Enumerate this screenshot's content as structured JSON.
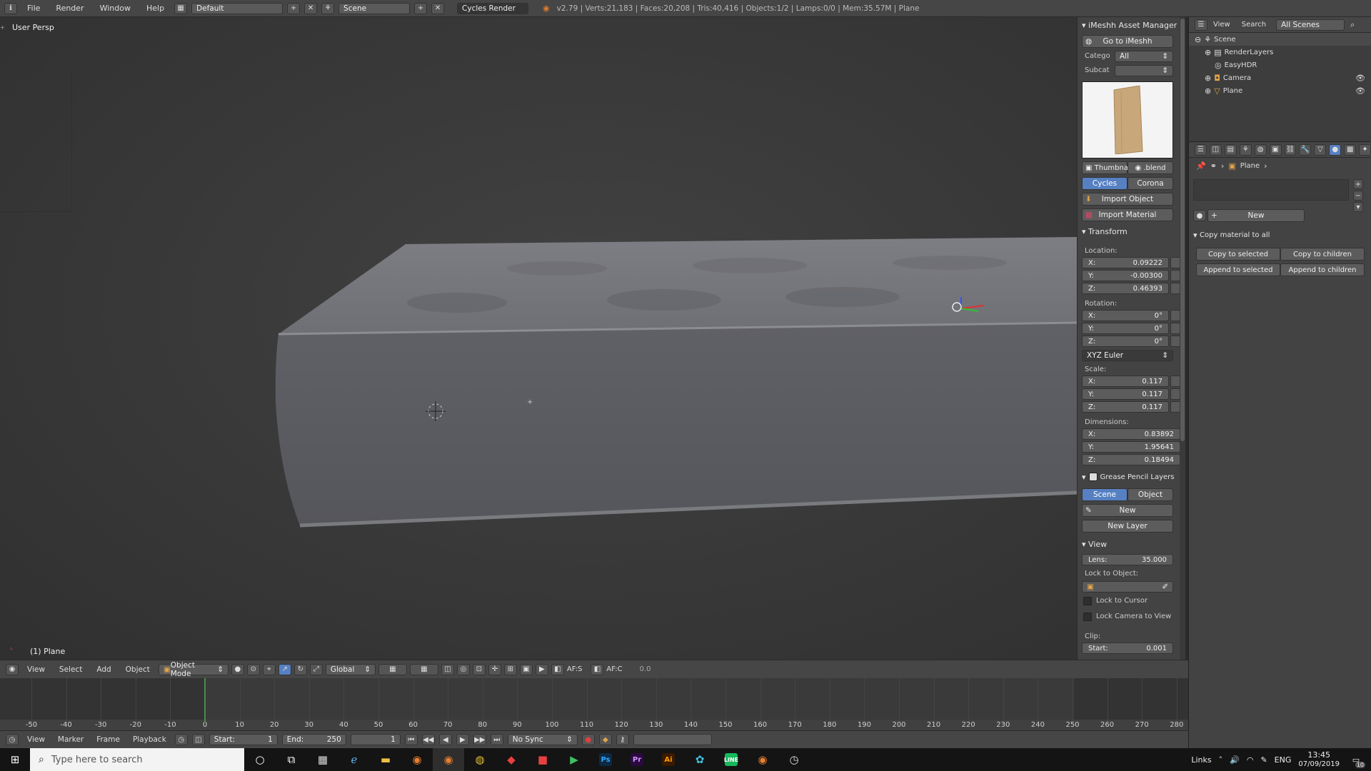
{
  "topbar": {
    "menus": [
      "File",
      "Render",
      "Window",
      "Help"
    ],
    "layout": "Default",
    "scene": "Scene",
    "engine": "Cycles Render",
    "stats": "v2.79 | Verts:21,183 | Faces:20,208 | Tris:40,416 | Objects:1/2 | Lamps:0/0 | Mem:35.57M | Plane"
  },
  "viewport": {
    "view_label": "User Persp",
    "object_label": "(1) Plane"
  },
  "imeshh": {
    "title": "iMeshh Asset Manager",
    "goto": "Go to iMeshh",
    "category_label": "Catego",
    "category_value": "All",
    "subcat_label": "Subcat",
    "subcat_value": "",
    "thumbnail": "Thumbnai",
    "blend": ".blend",
    "renderer_tabs": [
      "Cycles",
      "Corona"
    ],
    "import_object": "Import Object",
    "import_material": "Import Material"
  },
  "transform": {
    "title": "Transform",
    "location_label": "Location:",
    "location": [
      {
        "axis": "X:",
        "value": "0.09222"
      },
      {
        "axis": "Y:",
        "value": "-0.00300"
      },
      {
        "axis": "Z:",
        "value": "0.46393"
      }
    ],
    "rotation_label": "Rotation:",
    "rotation": [
      {
        "axis": "X:",
        "value": "0°"
      },
      {
        "axis": "Y:",
        "value": "0°"
      },
      {
        "axis": "Z:",
        "value": "0°"
      }
    ],
    "rotation_mode": "XYZ Euler",
    "scale_label": "Scale:",
    "scale": [
      {
        "axis": "X:",
        "value": "0.117"
      },
      {
        "axis": "Y:",
        "value": "0.117"
      },
      {
        "axis": "Z:",
        "value": "0.117"
      }
    ],
    "dimensions_label": "Dimensions:",
    "dimensions": [
      {
        "axis": "X:",
        "value": "0.83892"
      },
      {
        "axis": "Y:",
        "value": "1.95641"
      },
      {
        "axis": "Z:",
        "value": "0.18494"
      }
    ]
  },
  "grease": {
    "title": "Grease Pencil Layers",
    "tabs": [
      "Scene",
      "Object"
    ],
    "new": "New",
    "new_layer": "New Layer"
  },
  "view_panel": {
    "title": "View",
    "lens_label": "Lens:",
    "lens_value": "35.000",
    "lock_object": "Lock to Object:",
    "lock_cursor": "Lock to Cursor",
    "lock_camera": "Lock Camera to View",
    "clip_label": "Clip:",
    "clip_start_label": "Start:",
    "clip_start_value": "0.001"
  },
  "outliner": {
    "view": "View",
    "search": "Search",
    "scenes": "All Scenes",
    "items": [
      {
        "name": "Scene",
        "indent": 0
      },
      {
        "name": "RenderLayers",
        "indent": 1
      },
      {
        "name": "EasyHDR",
        "indent": 1
      },
      {
        "name": "Camera",
        "indent": 1
      },
      {
        "name": "Plane",
        "indent": 1
      }
    ]
  },
  "properties": {
    "breadcrumb": "Plane",
    "new": "New",
    "copy_title": "Copy material to all",
    "copy_selected": "Copy to selected",
    "copy_children": "Copy to children",
    "append_selected": "Append to selected",
    "append_children": "Append to children"
  },
  "header3d": {
    "menus": [
      "View",
      "Select",
      "Add",
      "Object"
    ],
    "mode": "Object Mode",
    "orientation": "Global",
    "afs": "AF:S",
    "afc": "AF:C",
    "value": "0.0"
  },
  "timeline": {
    "ticks": [
      "-50",
      "-40",
      "-30",
      "-20",
      "-10",
      "0",
      "10",
      "20",
      "30",
      "40",
      "50",
      "60",
      "70",
      "80",
      "90",
      "100",
      "110",
      "120",
      "130",
      "140",
      "150",
      "160",
      "170",
      "180",
      "190",
      "200",
      "210",
      "220",
      "230",
      "240",
      "250",
      "260",
      "270",
      "280"
    ],
    "menus": [
      "View",
      "Marker",
      "Frame",
      "Playback"
    ],
    "start_label": "Start:",
    "start_value": "1",
    "end_label": "End:",
    "end_value": "250",
    "current": "1",
    "sync": "No Sync"
  },
  "taskbar": {
    "search_placeholder": "Type here to search",
    "links": "Links",
    "lang": "ENG",
    "time": "13:45",
    "date": "07/09/2019",
    "notif": "10"
  },
  "colors": {
    "accent": "#5680c2",
    "bg": "#434343"
  }
}
